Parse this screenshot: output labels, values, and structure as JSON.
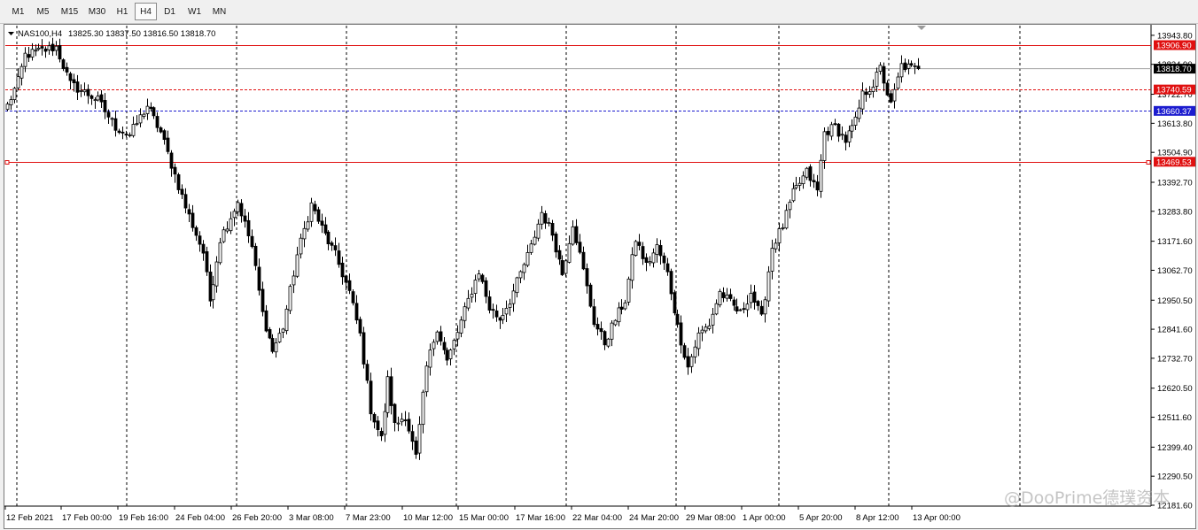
{
  "toolbar": {
    "timeframes": [
      "M1",
      "M5",
      "M15",
      "M30",
      "H1",
      "H4",
      "D1",
      "W1",
      "MN"
    ],
    "active": "H4"
  },
  "chart_header": {
    "symbol": "NAS100,H4",
    "ohlc": "13825.30 13837.50 13816.50 13818.70"
  },
  "watermark": "@DooPrime德璞资本",
  "colors": {
    "candle": "#000000",
    "grid": "#000000",
    "resistance": "#e01010",
    "mid_level": "#e01010",
    "support_blue": "#1c1ccf",
    "current_price_bg": "#000000"
  },
  "chart_data": {
    "type": "candlestick",
    "symbol": "NAS100",
    "timeframe": "H4",
    "ylim": [
      12181.6,
      13970
    ],
    "grid": true,
    "y_ticks": [
      "13943.80",
      "13834.90",
      "13722.70",
      "13613.80",
      "13504.90",
      "13392.70",
      "13283.80",
      "13171.60",
      "13062.70",
      "12950.50",
      "12841.60",
      "12732.70",
      "12620.50",
      "12511.60",
      "12399.40",
      "12290.50",
      "12181.60"
    ],
    "x_ticks": [
      "12 Feb 2021",
      "17 Feb 00:00",
      "19 Feb 16:00",
      "24 Feb 04:00",
      "26 Feb 20:00",
      "3 Mar 08:00",
      "7 Mar 23:00",
      "10 Mar 12:00",
      "15 Mar 00:00",
      "17 Mar 16:00",
      "22 Mar 04:00",
      "24 Mar 20:00",
      "29 Mar 08:00",
      "1 Apr 00:00",
      "5 Apr 20:00",
      "8 Apr 12:00",
      "13 Apr 00:00"
    ],
    "levels": [
      {
        "label": "13906.90",
        "price": 13906.9,
        "style": "solid",
        "color": "#e01010"
      },
      {
        "label": "13740.59",
        "price": 13740.59,
        "style": "dashed",
        "color": "#e01010"
      },
      {
        "label": "13660.37",
        "price": 13660.37,
        "style": "dashed",
        "color": "#1c1ccf"
      },
      {
        "label": "13469.53",
        "price": 13469.53,
        "style": "solid",
        "color": "#e01010"
      }
    ],
    "current_price": "13818.70",
    "anchors": [
      [
        0,
        13680
      ],
      [
        3,
        13770
      ],
      [
        5,
        13870
      ],
      [
        14,
        13900
      ],
      [
        18,
        13760
      ],
      [
        26,
        13700
      ],
      [
        31,
        13600
      ],
      [
        35,
        13570
      ],
      [
        40,
        13680
      ],
      [
        44,
        13580
      ],
      [
        48,
        13420
      ],
      [
        51,
        13300
      ],
      [
        56,
        13130
      ],
      [
        58,
        12950
      ],
      [
        61,
        13180
      ],
      [
        66,
        13320
      ],
      [
        70,
        13150
      ],
      [
        73,
        12900
      ],
      [
        76,
        12760
      ],
      [
        79,
        12850
      ],
      [
        83,
        13120
      ],
      [
        87,
        13310
      ],
      [
        90,
        13220
      ],
      [
        94,
        13120
      ],
      [
        98,
        12980
      ],
      [
        101,
        12820
      ],
      [
        104,
        12540
      ],
      [
        107,
        12430
      ],
      [
        109,
        12650
      ],
      [
        111,
        12480
      ],
      [
        114,
        12520
      ],
      [
        117,
        12360
      ],
      [
        120,
        12700
      ],
      [
        123,
        12850
      ],
      [
        126,
        12720
      ],
      [
        129,
        12830
      ],
      [
        132,
        12950
      ],
      [
        135,
        13060
      ],
      [
        138,
        12920
      ],
      [
        141,
        12880
      ],
      [
        144,
        12950
      ],
      [
        147,
        13050
      ],
      [
        150,
        13150
      ],
      [
        153,
        13280
      ],
      [
        156,
        13200
      ],
      [
        159,
        13050
      ],
      [
        162,
        13240
      ],
      [
        165,
        13060
      ],
      [
        168,
        12870
      ],
      [
        171,
        12790
      ],
      [
        174,
        12880
      ],
      [
        177,
        12950
      ],
      [
        180,
        13180
      ],
      [
        183,
        13080
      ],
      [
        186,
        13150
      ],
      [
        189,
        13050
      ],
      [
        192,
        12850
      ],
      [
        195,
        12700
      ],
      [
        198,
        12820
      ],
      [
        201,
        12860
      ],
      [
        204,
        12980
      ],
      [
        207,
        12940
      ],
      [
        210,
        12900
      ],
      [
        213,
        12980
      ],
      [
        216,
        12880
      ],
      [
        219,
        13150
      ],
      [
        222,
        13230
      ],
      [
        225,
        13350
      ],
      [
        229,
        13430
      ],
      [
        232,
        13360
      ],
      [
        234,
        13580
      ],
      [
        237,
        13600
      ],
      [
        240,
        13550
      ],
      [
        243,
        13620
      ],
      [
        245,
        13720
      ],
      [
        248,
        13760
      ],
      [
        250,
        13820
      ],
      [
        253,
        13680
      ],
      [
        256,
        13830
      ],
      [
        259,
        13820
      ],
      [
        261,
        13818.7
      ]
    ]
  }
}
